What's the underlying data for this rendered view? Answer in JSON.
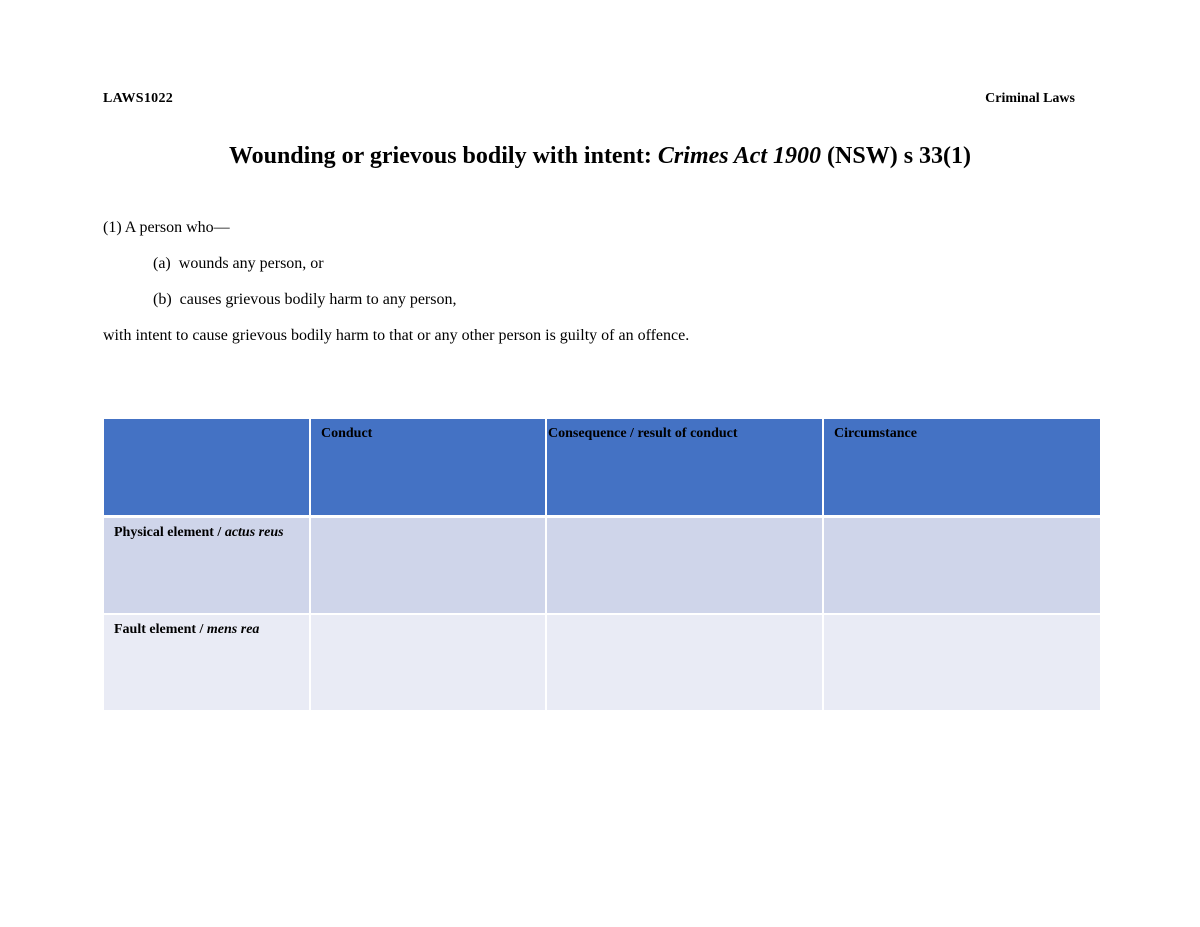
{
  "header": {
    "course_code": "LAWS1022",
    "course_name": "Criminal Laws"
  },
  "title": {
    "prefix": "Wounding or grievous bodily with intent: ",
    "act_name": "Crimes Act 1900",
    "suffix": " (NSW) s 33(1)"
  },
  "provision": {
    "intro": "(1) A person who—",
    "items": [
      {
        "marker": "(a)",
        "text": "wounds any person, or"
      },
      {
        "marker": "(b)",
        "text": "causes grievous bodily harm to any person,"
      }
    ],
    "closing": "with intent to cause grievous bodily harm to that or any other person is guilty of an offence."
  },
  "table": {
    "columns": [
      "",
      "Conduct",
      "Consequence / result of conduct",
      "Circumstance"
    ],
    "rows": [
      {
        "label": "Physical element / ",
        "label_italic": "actus reus",
        "cells": [
          "",
          "",
          ""
        ]
      },
      {
        "label": "Fault element / ",
        "label_italic": "mens rea",
        "cells": [
          "",
          "",
          ""
        ]
      }
    ],
    "colors": {
      "header_bg": "#4472c4",
      "row_odd_bg": "#cfd5ea",
      "row_even_bg": "#e9ebf5"
    }
  }
}
